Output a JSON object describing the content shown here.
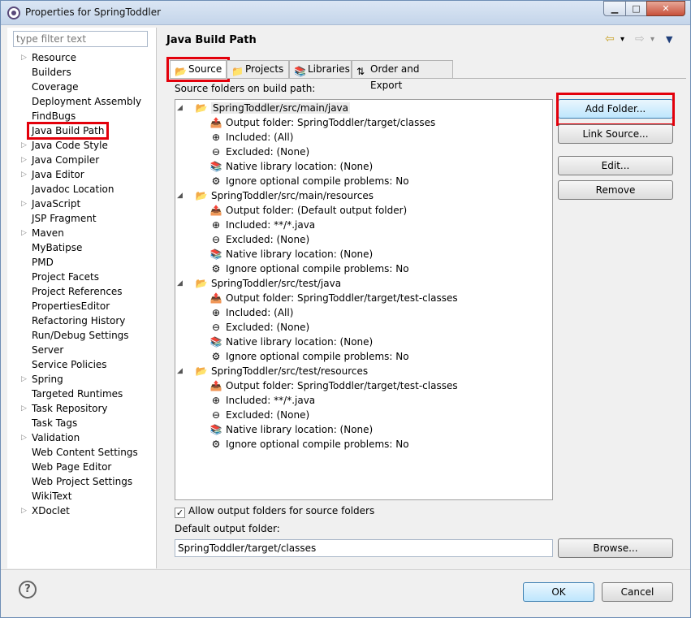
{
  "window": {
    "title": "Properties for SpringToddler",
    "min": "▁",
    "max": "□",
    "close": "✕"
  },
  "filter": {
    "placeholder": "type filter text"
  },
  "nav": [
    {
      "label": "Resource",
      "twisty": "▷"
    },
    {
      "label": "Builders",
      "twisty": ""
    },
    {
      "label": "Coverage",
      "twisty": ""
    },
    {
      "label": "Deployment Assembly",
      "twisty": ""
    },
    {
      "label": "FindBugs",
      "twisty": ""
    },
    {
      "label": "Java Build Path",
      "twisty": "",
      "selected": true
    },
    {
      "label": "Java Code Style",
      "twisty": "▷"
    },
    {
      "label": "Java Compiler",
      "twisty": "▷"
    },
    {
      "label": "Java Editor",
      "twisty": "▷"
    },
    {
      "label": "Javadoc Location",
      "twisty": ""
    },
    {
      "label": "JavaScript",
      "twisty": "▷"
    },
    {
      "label": "JSP Fragment",
      "twisty": ""
    },
    {
      "label": "Maven",
      "twisty": "▷"
    },
    {
      "label": "MyBatipse",
      "twisty": ""
    },
    {
      "label": "PMD",
      "twisty": ""
    },
    {
      "label": "Project Facets",
      "twisty": ""
    },
    {
      "label": "Project References",
      "twisty": ""
    },
    {
      "label": "PropertiesEditor",
      "twisty": ""
    },
    {
      "label": "Refactoring History",
      "twisty": ""
    },
    {
      "label": "Run/Debug Settings",
      "twisty": ""
    },
    {
      "label": "Server",
      "twisty": ""
    },
    {
      "label": "Service Policies",
      "twisty": ""
    },
    {
      "label": "Spring",
      "twisty": "▷"
    },
    {
      "label": "Targeted Runtimes",
      "twisty": ""
    },
    {
      "label": "Task Repository",
      "twisty": "▷"
    },
    {
      "label": "Task Tags",
      "twisty": ""
    },
    {
      "label": "Validation",
      "twisty": "▷"
    },
    {
      "label": "Web Content Settings",
      "twisty": ""
    },
    {
      "label": "Web Page Editor",
      "twisty": ""
    },
    {
      "label": "Web Project Settings",
      "twisty": ""
    },
    {
      "label": "WikiText",
      "twisty": ""
    },
    {
      "label": "XDoclet",
      "twisty": "▷"
    }
  ],
  "page": {
    "title": "Java Build Path",
    "back": "⇦",
    "forward": "⇨",
    "dropdown": "▾",
    "menu": "▼"
  },
  "tabs": [
    {
      "label": "Source",
      "icon": "📂"
    },
    {
      "label": "Projects",
      "icon": "📁"
    },
    {
      "label": "Libraries",
      "icon": "📚"
    },
    {
      "label": "Order and Export",
      "icon": "⇅"
    }
  ],
  "source": {
    "label": "Source folders on build path:",
    "folders": [
      {
        "name": "SpringToddler/src/main/java",
        "twisty": "◢",
        "children": [
          "Output folder: SpringToddler/target/classes",
          "Included: (All)",
          "Excluded: (None)",
          "Native library location: (None)",
          "Ignore optional compile problems: No"
        ]
      },
      {
        "name": "SpringToddler/src/main/resources",
        "twisty": "◢",
        "children": [
          "Output folder: (Default output folder)",
          "Included: **/*.java",
          "Excluded: (None)",
          "Native library location: (None)",
          "Ignore optional compile problems: No"
        ]
      },
      {
        "name": "SpringToddler/src/test/java",
        "twisty": "◢",
        "children": [
          "Output folder: SpringToddler/target/test-classes",
          "Included: (All)",
          "Excluded: (None)",
          "Native library location: (None)",
          "Ignore optional compile problems: No"
        ]
      },
      {
        "name": "SpringToddler/src/test/resources",
        "twisty": "◢",
        "children": [
          "Output folder: SpringToddler/target/test-classes",
          "Included: **/*.java",
          "Excluded: (None)",
          "Native library location: (None)",
          "Ignore optional compile problems: No"
        ]
      }
    ],
    "child_icons": [
      "📤",
      "⊕",
      "⊖",
      "📚",
      "⚙"
    ],
    "folder_icon": "📂"
  },
  "buttons": {
    "add_folder": "Add Folder...",
    "link_source": "Link Source...",
    "edit": "Edit...",
    "remove": "Remove",
    "browse": "Browse...",
    "ok": "OK",
    "cancel": "Cancel"
  },
  "allow_output": {
    "label": "Allow output folders for source folders",
    "checked": true,
    "mark": "✓"
  },
  "default_output": {
    "label": "Default output folder:",
    "value": "SpringToddler/target/classes"
  },
  "help": {
    "glyph": "?"
  }
}
